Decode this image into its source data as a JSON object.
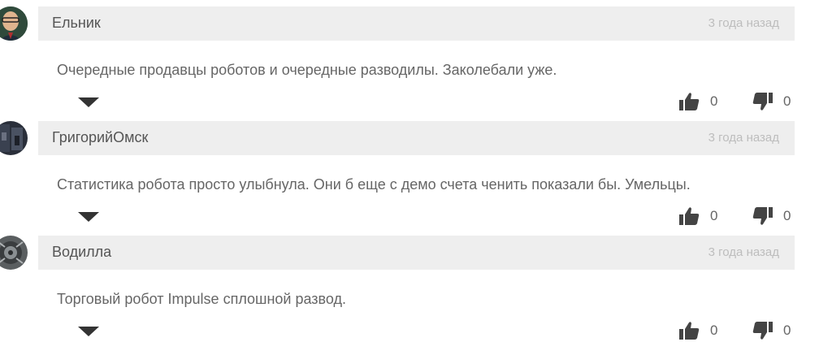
{
  "comments": [
    {
      "author": "Ельник",
      "time": "3 года назад",
      "text": "Очередные продавцы роботов и очередные разводилы. Заколебали уже.",
      "likes": "0",
      "dislikes": "0",
      "avatar_icon": "user-photo-avatar"
    },
    {
      "author": "ГригорийОмск",
      "time": "3 года назад",
      "text": "Статистика робота просто улыбнула. Они б еще с демо счета ченить показали бы. Умельцы.",
      "likes": "0",
      "dislikes": "0",
      "avatar_icon": "user-photo-avatar"
    },
    {
      "author": "Водилла",
      "time": "3 года назад",
      "text": "Торговый робот Impulse сплошной развод.",
      "likes": "0",
      "dislikes": "0",
      "avatar_icon": "user-photo-avatar"
    }
  ],
  "icons": {
    "like": "thumbs-up-icon",
    "dislike": "thumbs-down-icon",
    "expand": "triangle-down-icon"
  },
  "colors": {
    "header_bg": "#eeeeee",
    "text": "#666666",
    "author": "#555555",
    "timestamp": "#bdbdbd",
    "icon": "#444444"
  }
}
